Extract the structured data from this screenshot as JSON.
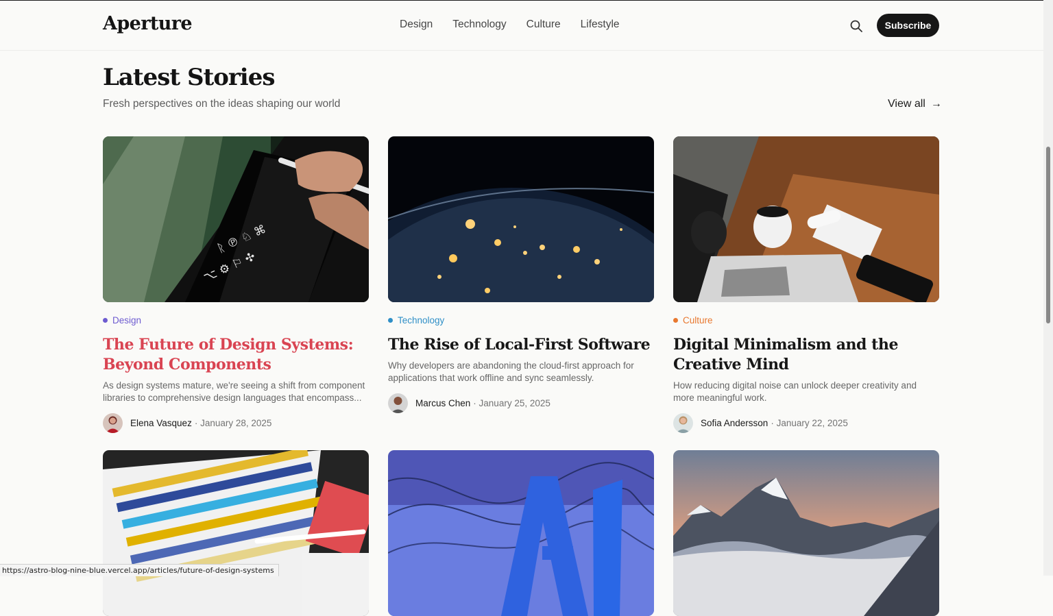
{
  "site": {
    "logo": "Aperture",
    "nav": [
      "Design",
      "Technology",
      "Culture",
      "Lifestyle"
    ],
    "subscribe_label": "Subscribe"
  },
  "section": {
    "title": "Latest Stories",
    "subtitle": "Fresh perspectives on the ideas shaping our world",
    "view_all_label": "View all",
    "view_all_arrow": "→"
  },
  "articles": [
    {
      "category": "Design",
      "category_color": "#6d5bd0",
      "title": "The Future of Design Systems: Beyond Components",
      "title_color": "#d94452",
      "excerpt": "As design systems mature, we're seeing a shift from component libraries to comprehensive design languages that encompass...",
      "author": "Elena Vasquez",
      "date": "· January 28, 2025",
      "image": "tablet-with-stylus-photo"
    },
    {
      "category": "Technology",
      "category_color": "#2f8fc7",
      "title": "The Rise of Local-First Software",
      "title_color": "#171717",
      "excerpt": "Why developers are abandoning the cloud-first approach for applications that work offline and sync seamlessly.",
      "author": "Marcus Chen",
      "date": "· January 25, 2025",
      "image": "earth-at-night-photo"
    },
    {
      "category": "Culture",
      "category_color": "#e8782f",
      "title": "Digital Minimalism and the Creative Mind",
      "title_color": "#171717",
      "excerpt": "How reducing digital noise can unlock deeper creativity and more meaningful work.",
      "author": "Sofia Andersson",
      "date": "· January 22, 2025",
      "image": "laptop-and-coffee-desk-photo"
    }
  ],
  "preview_images": [
    "color-swatches-photo",
    "ai-letters-photo",
    "mountain-sunset-photo"
  ],
  "status_url": "https://astro-blog-nine-blue.vercel.app/articles/future-of-design-systems"
}
